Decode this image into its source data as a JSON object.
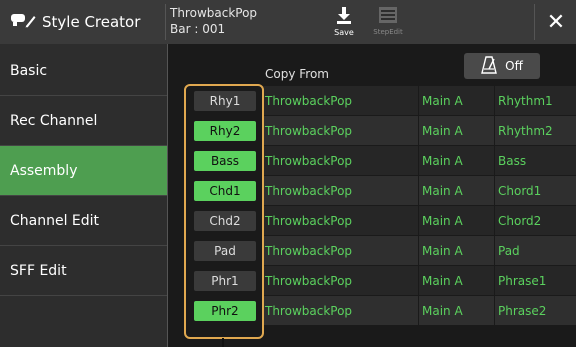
{
  "header": {
    "app_title": "Style Creator",
    "style_name": "ThrowbackPop",
    "bar_label": "Bar : 001",
    "save_label": "Save",
    "stepedit_label": "StepEdit"
  },
  "sidebar": {
    "items": [
      {
        "label": "Basic",
        "active": false
      },
      {
        "label": "Rec Channel",
        "active": false
      },
      {
        "label": "Assembly",
        "active": true
      },
      {
        "label": "Channel Edit",
        "active": false
      },
      {
        "label": "SFF Edit",
        "active": false
      }
    ]
  },
  "main": {
    "copy_from_label": "Copy From",
    "metronome_label": "Off",
    "rows": [
      {
        "channel": "Rhy1",
        "on": false,
        "style": "ThrowbackPop",
        "section": "Main A",
        "source": "Rhythm1"
      },
      {
        "channel": "Rhy2",
        "on": true,
        "style": "ThrowbackPop",
        "section": "Main A",
        "source": "Rhythm2"
      },
      {
        "channel": "Bass",
        "on": true,
        "style": "ThrowbackPop",
        "section": "Main A",
        "source": "Bass"
      },
      {
        "channel": "Chd1",
        "on": true,
        "style": "ThrowbackPop",
        "section": "Main A",
        "source": "Chord1"
      },
      {
        "channel": "Chd2",
        "on": false,
        "style": "ThrowbackPop",
        "section": "Main A",
        "source": "Chord2"
      },
      {
        "channel": "Pad",
        "on": false,
        "style": "ThrowbackPop",
        "section": "Main A",
        "source": "Pad"
      },
      {
        "channel": "Phr1",
        "on": false,
        "style": "ThrowbackPop",
        "section": "Main A",
        "source": "Phrase1"
      },
      {
        "channel": "Phr2",
        "on": true,
        "style": "ThrowbackPop",
        "section": "Main A",
        "source": "Phrase2"
      }
    ]
  },
  "colors": {
    "accent_green": "#5bd15e",
    "active_tab": "#4e9e50",
    "highlight": "#e0a850"
  }
}
